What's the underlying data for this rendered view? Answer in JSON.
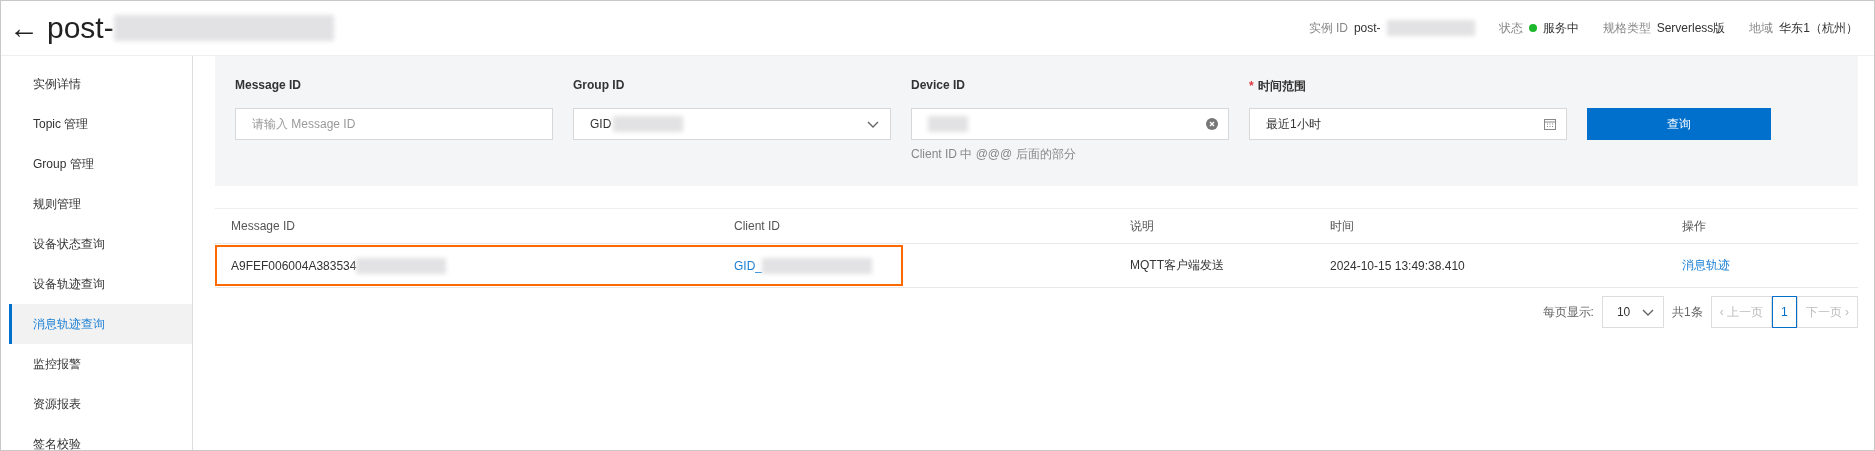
{
  "header": {
    "back": "←",
    "title": "post-",
    "meta": [
      {
        "label": "实例 ID",
        "value": "post-",
        "redacted": true
      },
      {
        "label": "状态",
        "value": "服务中",
        "online": true
      },
      {
        "label": "规格类型",
        "value": "Serverless版"
      },
      {
        "label": "地域",
        "value": "华东1（杭州）"
      }
    ]
  },
  "sidebar": {
    "items": [
      {
        "label": "实例详情",
        "selected": false
      },
      {
        "label": "Topic 管理",
        "selected": false
      },
      {
        "label": "Group 管理",
        "selected": false
      },
      {
        "label": "规则管理",
        "selected": false
      },
      {
        "label": "设备状态查询",
        "selected": false
      },
      {
        "label": "设备轨迹查询",
        "selected": false
      },
      {
        "label": "消息轨迹查询",
        "selected": true
      },
      {
        "label": "监控报警",
        "selected": false
      },
      {
        "label": "资源报表",
        "selected": false
      },
      {
        "label": "签名校验",
        "selected": false
      }
    ]
  },
  "filters": [
    {
      "kind": "input",
      "label": "Message ID",
      "placeholder": "请输入 Message ID"
    },
    {
      "kind": "select",
      "label": "Group ID",
      "value": "GID"
    },
    {
      "kind": "clearable",
      "label": "Device ID",
      "hint": "Client ID 中 @@@ 后面的部分"
    },
    {
      "kind": "date",
      "label": "时间范围",
      "required_mark": "*",
      "value": "最近1小时"
    }
  ],
  "query_button": "查询",
  "table": {
    "columns": [
      "Message ID",
      "Client ID",
      "说明",
      "时间",
      "操作"
    ],
    "rows": [
      {
        "message_id": "A9FEF006004A383534",
        "client_id": "GID_",
        "description": "MQTT客户端发送",
        "time": "2024-10-15 13:49:38.410",
        "action": "消息轨迹",
        "highlighted": true
      }
    ]
  },
  "pagination": {
    "per_page_label": "每页显示:",
    "per_page": "10",
    "total": "共1条",
    "prev_icon": "‹",
    "prev": "上一页",
    "pages": [
      {
        "label": "1",
        "selected": true
      }
    ],
    "next": "下一页",
    "next_icon": "›"
  }
}
